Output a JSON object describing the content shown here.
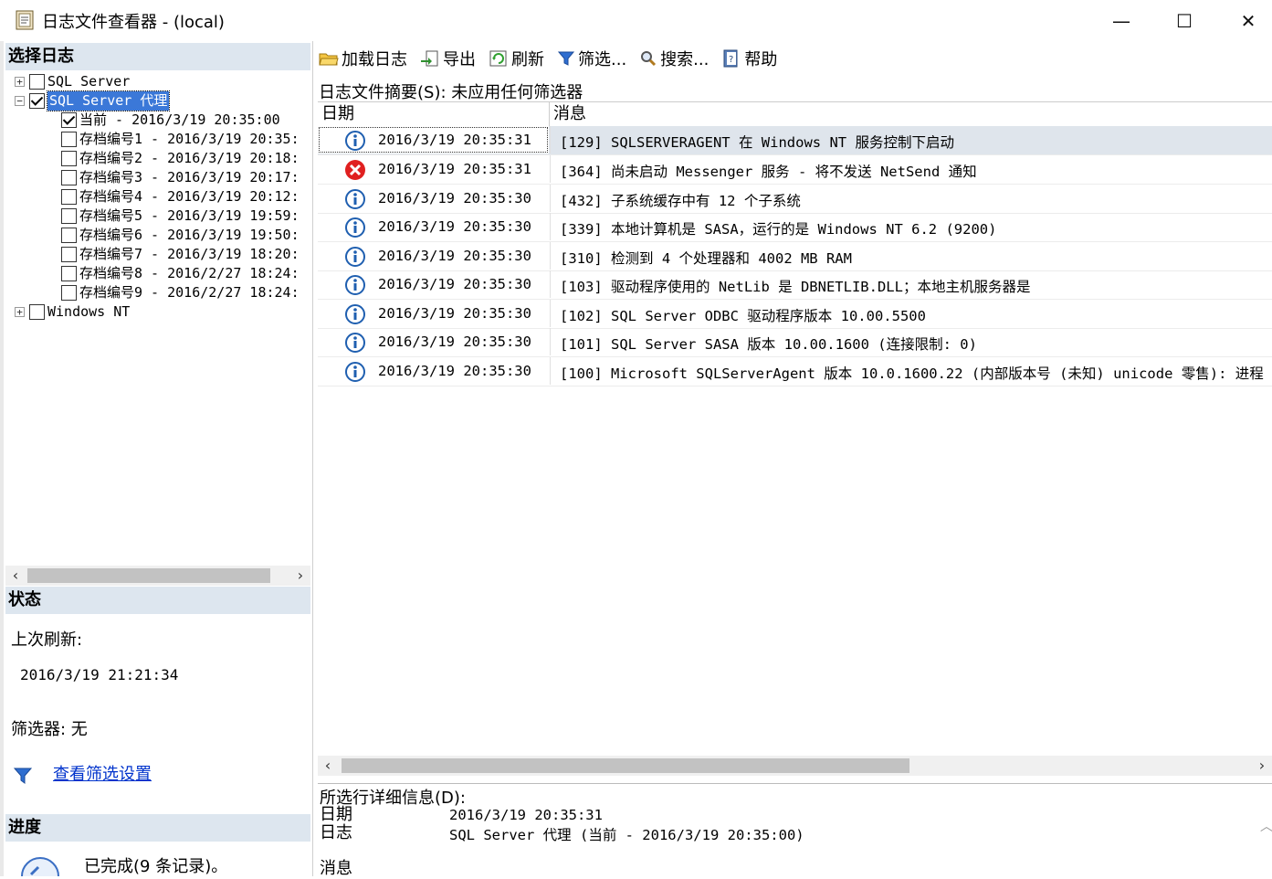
{
  "window": {
    "title": "日志文件查看器 - (local)",
    "minimize": "—",
    "maximize": "☐",
    "close": "✕"
  },
  "left": {
    "select_header": "选择日志",
    "tree": [
      {
        "label": "SQL Server",
        "expander": "+",
        "checked": false
      },
      {
        "label": "SQL Server 代理",
        "expander": "−",
        "checked": true,
        "selected": true
      },
      {
        "label": "当前 - 2016/3/19 20:35:00",
        "checked": true
      },
      {
        "label": "存档编号1 - 2016/3/19 20:35:",
        "checked": false
      },
      {
        "label": "存档编号2 - 2016/3/19 20:18:",
        "checked": false
      },
      {
        "label": "存档编号3 - 2016/3/19 20:17:",
        "checked": false
      },
      {
        "label": "存档编号4 - 2016/3/19 20:12:",
        "checked": false
      },
      {
        "label": "存档编号5 - 2016/3/19 19:59:",
        "checked": false
      },
      {
        "label": "存档编号6 - 2016/3/19 19:50:",
        "checked": false
      },
      {
        "label": "存档编号7 - 2016/3/19 18:20:",
        "checked": false
      },
      {
        "label": "存档编号8 - 2016/2/27 18:24:",
        "checked": false
      },
      {
        "label": "存档编号9 - 2016/2/27 18:24:",
        "checked": false
      },
      {
        "label": "Windows NT",
        "expander": "+",
        "checked": false
      }
    ],
    "status_header": "状态",
    "last_refresh_label": "上次刷新:",
    "last_refresh_value": "2016/3/19 21:21:34",
    "filter_label": "筛选器: 无",
    "view_filter_link": "查看筛选设置",
    "progress_header": "进度",
    "progress_text": "已完成(9 条记录)。"
  },
  "toolbar": {
    "load": "加载日志",
    "export": "导出",
    "refresh": "刷新",
    "filter": "筛选...",
    "search": "搜索...",
    "help": "帮助"
  },
  "summary": "日志文件摘要(S): 未应用任何筛选器",
  "grid": {
    "col_date": "日期",
    "col_message": "消息",
    "rows": [
      {
        "icon": "info-icon",
        "date": "2016/3/19 20:35:31",
        "message": "[129] SQLSERVERAGENT 在 Windows NT 服务控制下启动"
      },
      {
        "icon": "error-icon",
        "date": "2016/3/19 20:35:31",
        "message": "[364] 尚未启动 Messenger 服务 - 将不发送 NetSend 通知"
      },
      {
        "icon": "info-icon",
        "date": "2016/3/19 20:35:30",
        "message": "[432] 子系统缓存中有 12 个子系统"
      },
      {
        "icon": "info-icon",
        "date": "2016/3/19 20:35:30",
        "message": "[339] 本地计算机是 SASA，运行的是 Windows NT 6.2 (9200)"
      },
      {
        "icon": "info-icon",
        "date": "2016/3/19 20:35:30",
        "message": "[310] 检测到 4 个处理器和 4002 MB RAM"
      },
      {
        "icon": "info-icon",
        "date": "2016/3/19 20:35:30",
        "message": "[103] 驱动程序使用的 NetLib 是 DBNETLIB.DLL；本地主机服务器是"
      },
      {
        "icon": "info-icon",
        "date": "2016/3/19 20:35:30",
        "message": "[102] SQL Server ODBC 驱动程序版本 10.00.5500"
      },
      {
        "icon": "info-icon",
        "date": "2016/3/19 20:35:30",
        "message": "[101] SQL Server SASA 版本 10.00.1600 (连接限制: 0)"
      },
      {
        "icon": "info-icon",
        "date": "2016/3/19 20:35:30",
        "message": "[100] Microsoft SQLServerAgent 版本 10.0.1600.22 (内部版本号 (未知) unicode 零售): 进程"
      }
    ]
  },
  "details": {
    "header": "所选行详细信息(D):",
    "date_label": "日期",
    "date_value": "2016/3/19 20:35:31",
    "log_label": "日志",
    "log_value": "SQL Server 代理 (当前 - 2016/3/19 20:35:00)",
    "message_label": "消息"
  },
  "colors": {
    "section_header_bg": "#dde6ef",
    "selected_row_bg": "#dfe5ec",
    "selection_blue": "#3b78d8",
    "link": "#0033cc",
    "info_icon": "#1f5fb0",
    "error_icon": "#e02020"
  }
}
